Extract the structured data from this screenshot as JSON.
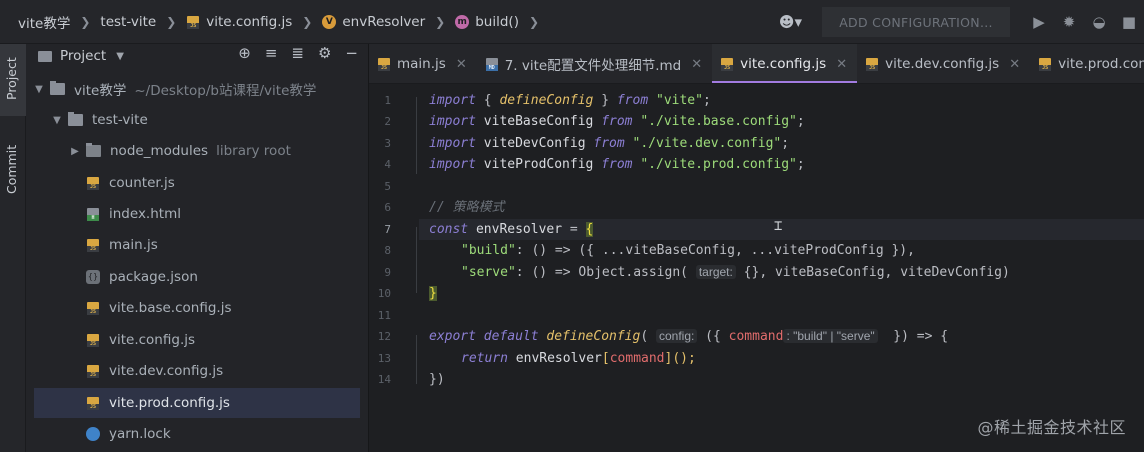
{
  "breadcrumbs": [
    {
      "label": "vite教学"
    },
    {
      "label": "test-vite"
    },
    {
      "label": "vite.config.js",
      "icon": "js-file-icon"
    },
    {
      "label": "envResolver",
      "icon": "variable-icon",
      "badge": "V"
    },
    {
      "label": "build()",
      "icon": "method-icon",
      "badge": "m"
    }
  ],
  "toolbar": {
    "config_label": "ADD CONFIGURATION...",
    "icons": [
      "run-icon",
      "debug-icon",
      "coverage-icon",
      "stop-icon"
    ]
  },
  "toolstrip": {
    "project_label": "Project",
    "commit_label": "Commit"
  },
  "project_panel": {
    "title": "Project",
    "tools": [
      "locate-icon",
      "expand-all-icon",
      "collapse-all-icon",
      "settings-icon",
      "hide-icon"
    ],
    "tree": [
      {
        "label": "vite教学",
        "suffix": "~/Desktop/b站课程/vite教学",
        "type": "dir",
        "open": true,
        "depth": 0
      },
      {
        "label": "test-vite",
        "suffix": "",
        "type": "dir",
        "open": true,
        "depth": 1
      },
      {
        "label": "node_modules",
        "suffix": "library root",
        "type": "dir",
        "open": false,
        "depth": 2
      },
      {
        "label": "counter.js",
        "type": "js",
        "depth": 2
      },
      {
        "label": "index.html",
        "type": "html",
        "depth": 2
      },
      {
        "label": "main.js",
        "type": "js",
        "depth": 2
      },
      {
        "label": "package.json",
        "type": "json",
        "depth": 2
      },
      {
        "label": "vite.base.config.js",
        "type": "js",
        "depth": 2
      },
      {
        "label": "vite.config.js",
        "type": "js",
        "depth": 2
      },
      {
        "label": "vite.dev.config.js",
        "type": "js",
        "depth": 2
      },
      {
        "label": "vite.prod.config.js",
        "type": "js",
        "depth": 2,
        "selected": true
      },
      {
        "label": "yarn.lock",
        "type": "yarn",
        "depth": 2
      }
    ]
  },
  "tabs": [
    {
      "label": "main.js",
      "type": "js"
    },
    {
      "label": "7. vite配置文件处理细节.md",
      "type": "md"
    },
    {
      "label": "vite.config.js",
      "type": "js",
      "active": true
    },
    {
      "label": "vite.dev.config.js",
      "type": "js"
    },
    {
      "label": "vite.prod.config.js",
      "type": "js"
    }
  ],
  "editor": {
    "line_numbers": [
      "1",
      "2",
      "3",
      "4",
      "5",
      "6",
      "7",
      "8",
      "9",
      "10",
      "11",
      "12",
      "13",
      "14"
    ],
    "current_line": "7"
  },
  "code": {
    "l1": {
      "kw": "import",
      "a": " { ",
      "fn": "defineConfig",
      "b": " } ",
      "kw2": "from",
      "str": " \"vite\"",
      "end": ";"
    },
    "l2": {
      "kw": "import",
      "id": " viteBaseConfig ",
      "kw2": "from",
      "str": " \"./vite.base.config\"",
      "end": ";"
    },
    "l3": {
      "kw": "import",
      "id": " viteDevConfig ",
      "kw2": "from",
      "str": " \"./vite.dev.config\"",
      "end": ";"
    },
    "l4": {
      "kw": "import",
      "id": " viteProdConfig ",
      "kw2": "from",
      "str": " \"./vite.prod.config\"",
      "end": ";"
    },
    "l6": {
      "comment": "// 策略模式"
    },
    "l7": {
      "kw": "const",
      "id": " envResolver ",
      "eq": "= ",
      "brace": "{"
    },
    "l8": {
      "key": "\"build\"",
      "rest": ": () => ({ ...viteBaseConfig, ...viteProdConfig }),"
    },
    "l9": {
      "key": "\"serve\"",
      "mid": ": () => Object.assign( ",
      "hint": "target:",
      "rest": " {}, viteBaseConfig, viteDevConfig)"
    },
    "l10": {
      "brace": "}"
    },
    "l12": {
      "kw": "export default",
      "fn": " defineConfig",
      "open": "( ",
      "hint": "config:",
      "a": " ({ ",
      "param": "command",
      "hint2": ": \"build\" | \"serve\"",
      "b": "  }) => {"
    },
    "l13": {
      "kw": "return",
      "id": " envResolver",
      "a": "[",
      "param": "command",
      "b": "]();"
    },
    "l14": {
      "text": "})"
    }
  },
  "watermark": "@稀土掘金技术社区"
}
